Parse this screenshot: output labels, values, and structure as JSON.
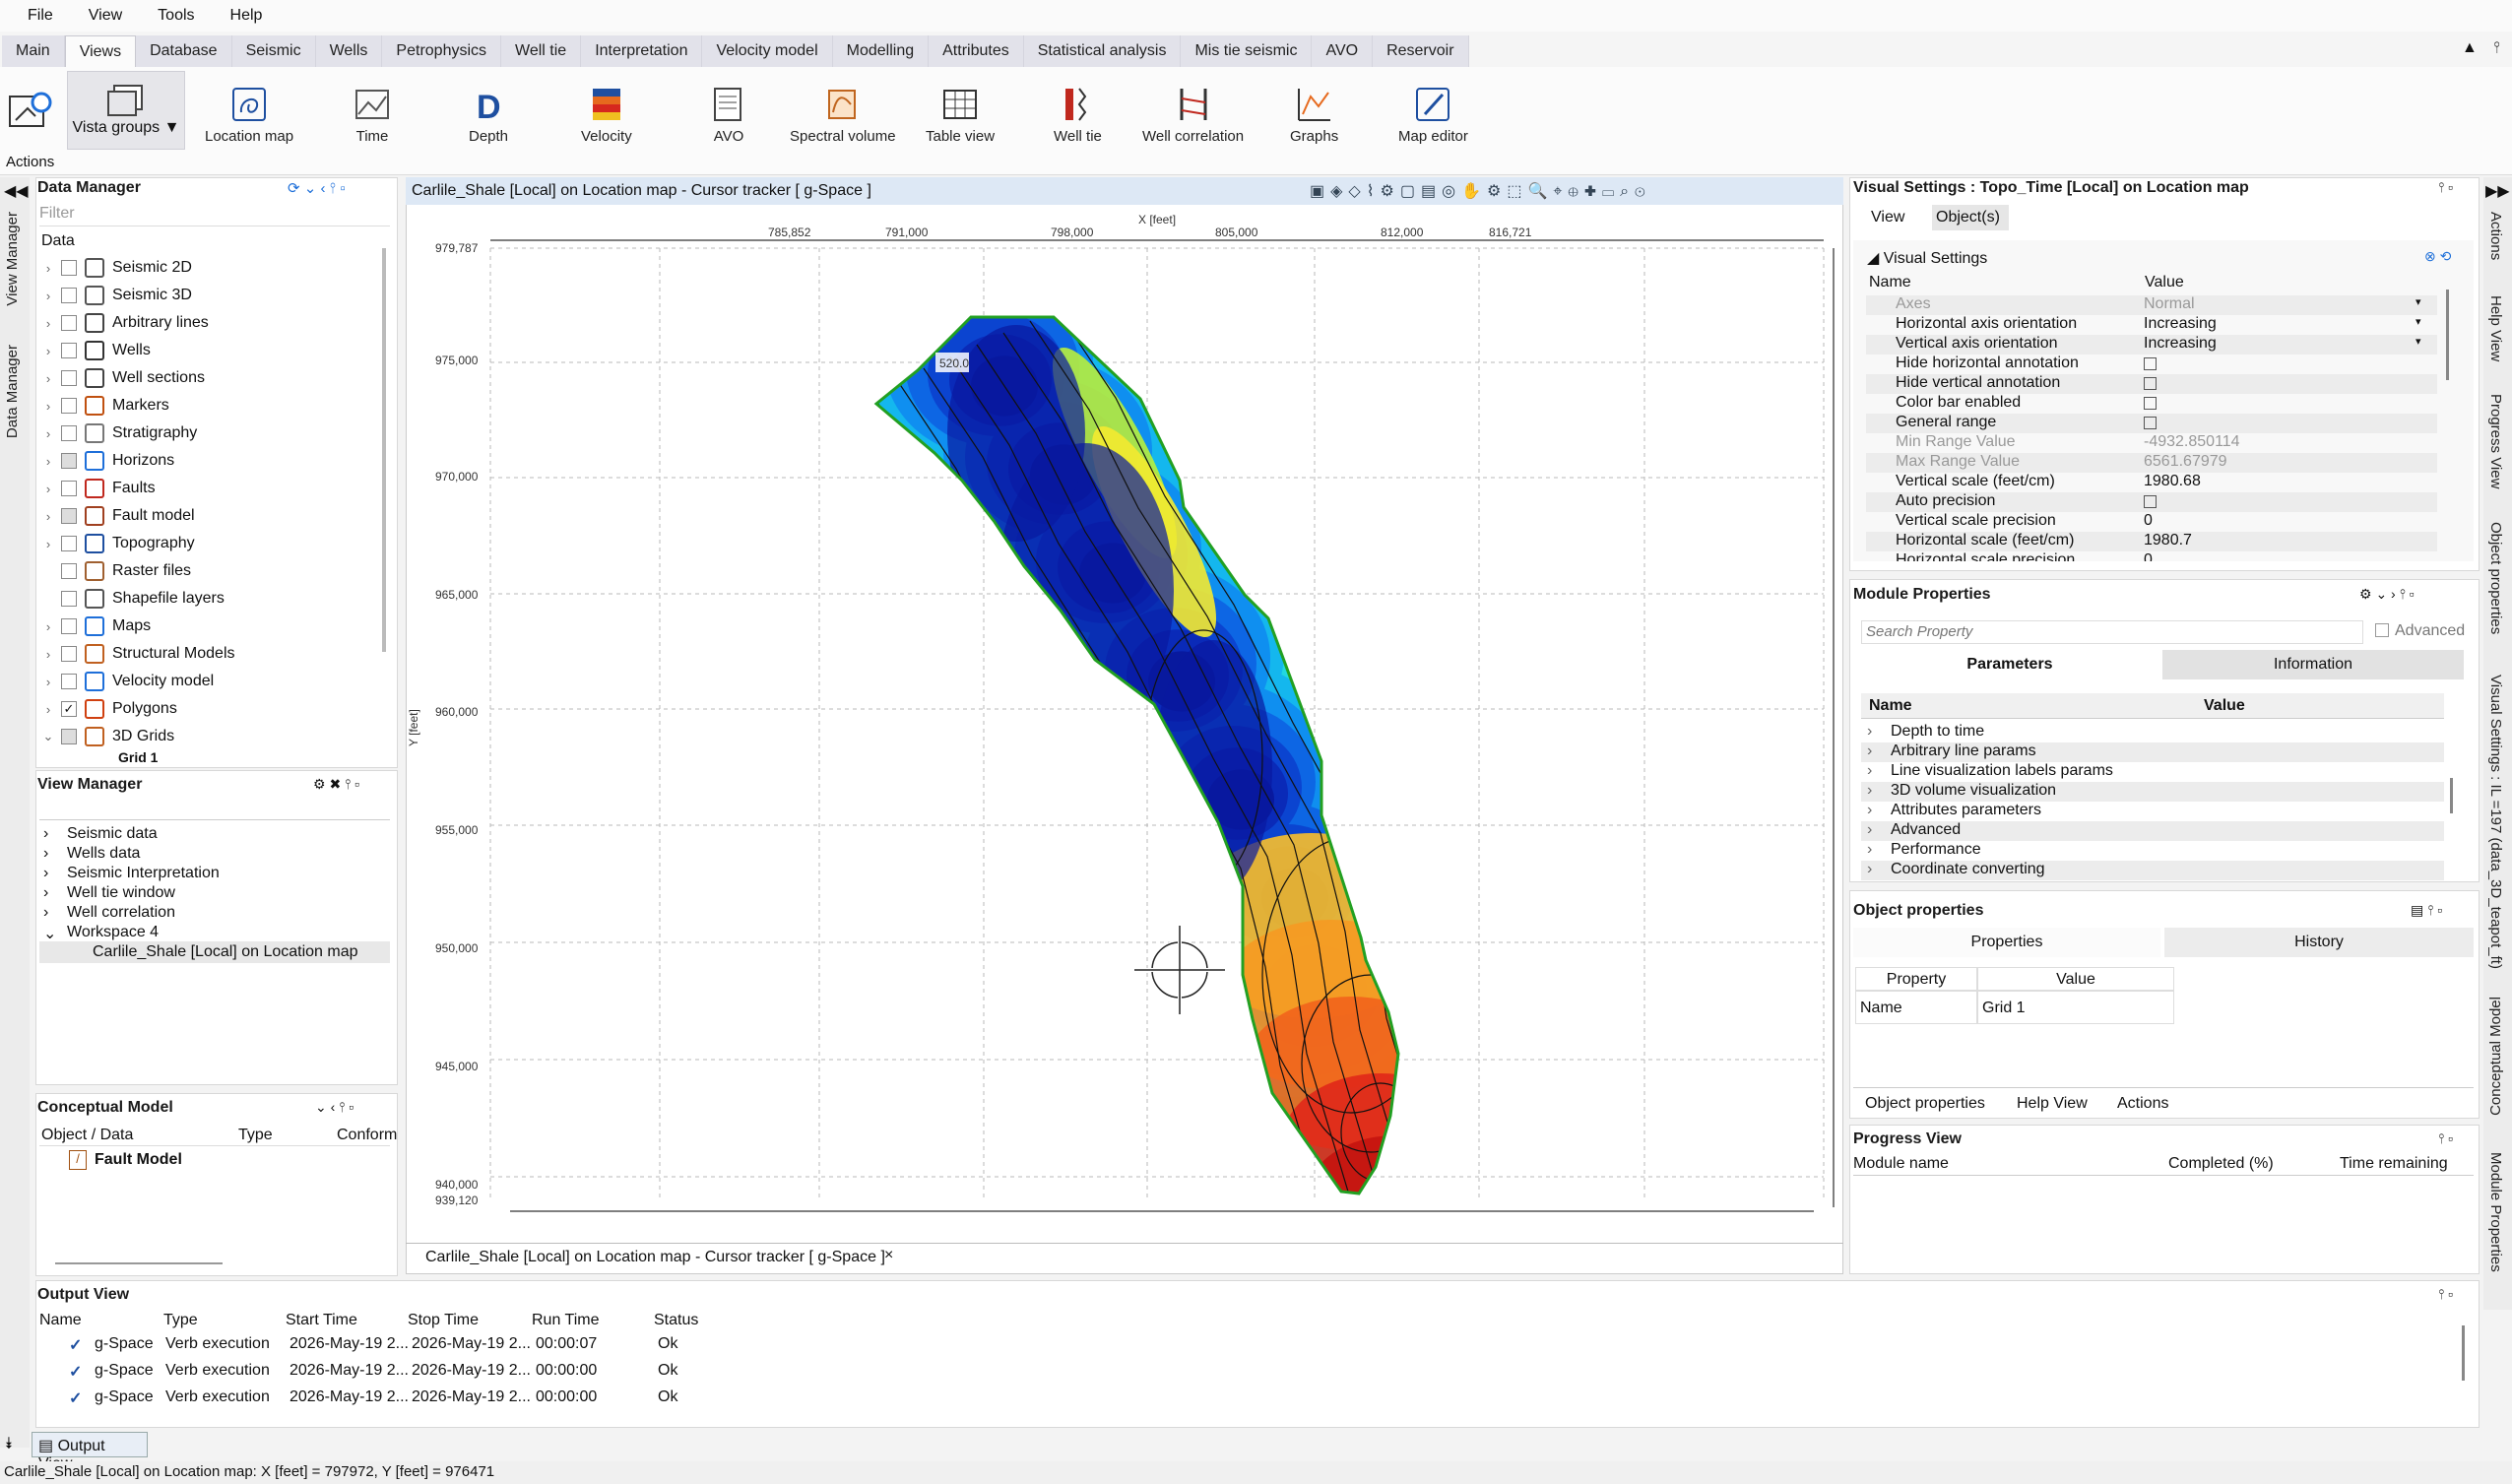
{
  "menu": [
    "File",
    "View",
    "Tools",
    "Help"
  ],
  "tabs": [
    "Main",
    "Views",
    "Database",
    "Seismic",
    "Wells",
    "Petrophysics",
    "Well tie",
    "Interpretation",
    "Velocity model",
    "Modelling",
    "Attributes",
    "Statistical analysis",
    "Mis tie seismic",
    "AVO",
    "Reservoir"
  ],
  "ribbon": {
    "actions_label": "Actions",
    "vista_label": "Vista groups ▼",
    "buttons": [
      "Location map",
      "Time",
      "Depth",
      "Velocity",
      "AVO",
      "Spectral volume",
      "Table view",
      "Well tie",
      "Well correlation",
      "Graphs",
      "Map editor"
    ]
  },
  "data_manager": {
    "title": "Data Manager",
    "filter_placeholder": "Filter",
    "header": "Data",
    "items": [
      "Seismic 2D",
      "Seismic 3D",
      "Arbitrary lines",
      "Wells",
      "Well sections",
      "Markers",
      "Stratigraphy",
      "Horizons",
      "Faults",
      "Fault model",
      "Topography",
      "Raster files",
      "Shapefile layers",
      "Maps",
      "Structural Models",
      "Velocity model",
      "Polygons",
      "3D Grids"
    ],
    "partial_item": "Grid 1"
  },
  "view_manager": {
    "title": "View Manager",
    "items": [
      "Seismic data",
      "Wells data",
      "Seismic Interpretation",
      "Well tie window",
      "Well correlation",
      "Workspace 4"
    ],
    "child": "Carlile_Shale [Local] on Location map"
  },
  "conceptual_model": {
    "title": "Conceptual Model",
    "columns": [
      "Object / Data",
      "Type",
      "Conform"
    ],
    "item": "Fault Model"
  },
  "map_view": {
    "title": "Carlile_Shale [Local] on Location map - Cursor tracker [ g-Space ]",
    "x_axis_label": "X [feet]",
    "y_axis_label": "Y [feet]",
    "x_ticks": [
      "785,852",
      "791,000",
      "798,000",
      "805,000",
      "812,000",
      "816,721"
    ],
    "y_ticks": [
      "979,787",
      "975,000",
      "970,000",
      "965,000",
      "960,000",
      "955,000",
      "950,000",
      "945,000",
      "940,000",
      "939,120"
    ],
    "contour_label": "520.0",
    "bottom_tab": "Carlile_Shale [Local] on Location map - Cursor tracker [ g-Space ]",
    "close_glyph": "×"
  },
  "visual_settings": {
    "title": "Visual Settings : Topo_Time [Local] on Location map",
    "tabs": [
      "View",
      "Object(s)"
    ],
    "section": "Visual Settings",
    "col_name": "Name",
    "col_value": "Value",
    "rows": [
      {
        "name": "Axes",
        "value": "Normal"
      },
      {
        "name": "Horizontal axis orientation",
        "value": "Increasing"
      },
      {
        "name": "Vertical axis orientation",
        "value": "Increasing"
      },
      {
        "name": "Hide horizontal annotation",
        "value": ""
      },
      {
        "name": "Hide vertical annotation",
        "value": ""
      },
      {
        "name": "Color bar enabled",
        "value": ""
      },
      {
        "name": "General range",
        "value": ""
      },
      {
        "name": "Min Range Value",
        "value": "-4932.850114"
      },
      {
        "name": "Max Range Value",
        "value": "6561.67979"
      },
      {
        "name": "Vertical scale (feet/cm)",
        "value": "1980.68"
      },
      {
        "name": "Auto precision",
        "value": ""
      },
      {
        "name": "Vertical scale precision",
        "value": "0"
      },
      {
        "name": "Horizontal scale (feet/cm)",
        "value": "1980.7"
      },
      {
        "name": "Horizontal scale precision",
        "value": "0"
      }
    ]
  },
  "module_properties": {
    "title": "Module Properties",
    "search_placeholder": "Search Property",
    "advanced_label": "Advanced",
    "tabs": [
      "Parameters",
      "Information"
    ],
    "col_name": "Name",
    "col_value": "Value",
    "items": [
      "Depth to time",
      "Arbitrary line params",
      "Line visualization labels params",
      "3D volume visualization",
      "Attributes parameters",
      "Advanced",
      "Performance",
      "Coordinate converting"
    ]
  },
  "object_properties": {
    "title": "Object properties",
    "tabs": [
      "Properties",
      "History"
    ],
    "col_property": "Property",
    "col_value": "Value",
    "row_name": "Name",
    "row_value": "Grid 1",
    "bottom_tabs": [
      "Object properties",
      "Help View",
      "Actions"
    ]
  },
  "progress_view": {
    "title": "Progress View",
    "columns": [
      "Module name",
      "Completed (%)",
      "Time remaining"
    ]
  },
  "output_view": {
    "title": "Output View",
    "columns": [
      "Name",
      "Type",
      "Start Time",
      "Stop Time",
      "Run Time",
      "Status"
    ],
    "rows": [
      {
        "name": "g-Space",
        "type": "Verb execution",
        "start": "2026-May-19 2...",
        "stop": "2026-May-19 2...",
        "run": "00:00:07",
        "status": "Ok"
      },
      {
        "name": "g-Space",
        "type": "Verb execution",
        "start": "2026-May-19 2...",
        "stop": "2026-May-19 2...",
        "run": "00:00:00",
        "status": "Ok"
      },
      {
        "name": "g-Space",
        "type": "Verb execution",
        "start": "2026-May-19 2...",
        "stop": "2026-May-19 2...",
        "run": "00:00:00",
        "status": "Ok"
      }
    ],
    "dock_tab": "Output View"
  },
  "side_tabs_left": [
    "View Manager",
    "Data Manager"
  ],
  "side_tabs_right": [
    "Actions",
    "Help View",
    "Progress View",
    "Object properties",
    "Visual Settings : IL =197 (data_3D_teapot_ft)",
    "Conceptual Model",
    "Module Properties"
  ],
  "status_bar": "Carlile_Shale [Local] on Location map:   X [feet] = 797972, Y [feet] = 976471",
  "colors": {
    "accent": "#1e6fd9",
    "title_bar": "#dde8f5",
    "polygon": "#22a022"
  }
}
